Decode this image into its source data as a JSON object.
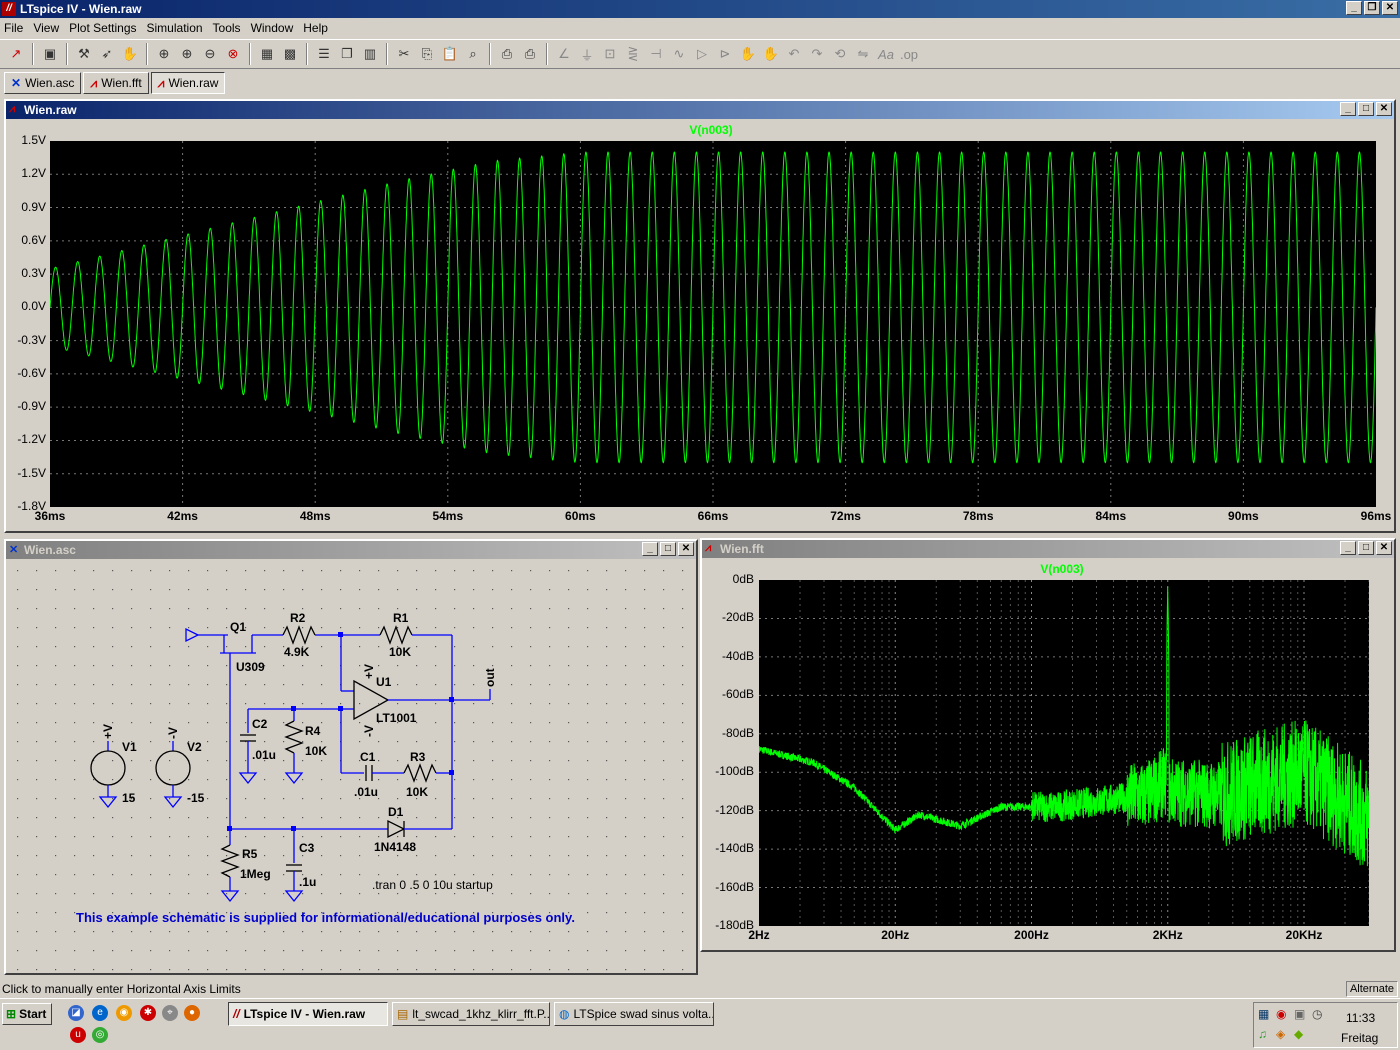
{
  "window": {
    "title": "LTspice IV - Wien.raw"
  },
  "menu": [
    "File",
    "View",
    "Plot Settings",
    "Simulation",
    "Tools",
    "Window",
    "Help"
  ],
  "tabs": [
    {
      "label": "Wien.asc",
      "icon": "schematic-icon"
    },
    {
      "label": "Wien.fft",
      "icon": "waveform-icon"
    },
    {
      "label": "Wien.raw",
      "icon": "waveform-icon"
    }
  ],
  "raw_window": {
    "title": "Wien.raw",
    "trace": "V(n003)",
    "yticks": [
      "1.5V",
      "1.2V",
      "0.9V",
      "0.6V",
      "0.3V",
      "0.0V",
      "-0.3V",
      "-0.6V",
      "-0.9V",
      "-1.2V",
      "-1.5V",
      "-1.8V"
    ],
    "xticks": [
      "36ms",
      "42ms",
      "48ms",
      "54ms",
      "60ms",
      "66ms",
      "72ms",
      "78ms",
      "84ms",
      "90ms",
      "96ms"
    ]
  },
  "asc_window": {
    "title": "Wien.asc",
    "labels": {
      "q1": "Q1",
      "u309": "U309",
      "r2": "R2",
      "r2v": "4.9K",
      "r1": "R1",
      "r1v": "10K",
      "u1": "U1",
      "lt1001": "LT1001",
      "vplus": "+V",
      "vminus": "-V",
      "out": "out",
      "c2": "C2",
      "c2v": ".01u",
      "r4": "R4",
      "r4v": "10K",
      "c1": "C1",
      "c1v": ".01u",
      "r3": "R3",
      "r3v": "10K",
      "d1": "D1",
      "d1v": "1N4148",
      "r5": "R5",
      "r5v": "1Meg",
      "c3": "C3",
      "c3v": ".1u",
      "v1": "V1",
      "v1v": "15",
      "v1n": "+V",
      "v2": "V2",
      "v2v": "-15",
      "v2n": "-V",
      "tran": ".tran 0 .5 0 10u startup",
      "notice": "This example schematic is supplied for informational/educational purposes only."
    }
  },
  "fft_window": {
    "title": "Wien.fft",
    "trace": "V(n003)",
    "yticks": [
      "0dB",
      "-20dB",
      "-40dB",
      "-60dB",
      "-80dB",
      "-100dB",
      "-120dB",
      "-140dB",
      "-160dB",
      "-180dB"
    ],
    "xticks": [
      "2Hz",
      "20Hz",
      "200Hz",
      "2KHz",
      "20KHz"
    ]
  },
  "chart_data": [
    {
      "type": "line",
      "title": "V(n003)",
      "xlabel": "",
      "ylabel": "",
      "xlim": [
        36,
        96
      ],
      "ylim": [
        -1.8,
        1.5
      ],
      "x_unit": "ms",
      "y_unit": "V",
      "series": [
        {
          "name": "V(n003)",
          "frequency_hz": 1000,
          "envelope": {
            "x": [
              36,
              40,
              44,
              48,
              52,
              56,
              60,
              96
            ],
            "amplitude": [
              0.35,
              0.55,
              0.75,
              0.95,
              1.15,
              1.32,
              1.4,
              1.4
            ]
          },
          "dc_offset": 0.0
        }
      ],
      "grid": true,
      "color": "#00ff00"
    },
    {
      "type": "line",
      "title": "V(n003)",
      "xlabel": "",
      "ylabel": "",
      "xscale": "log",
      "xlim": [
        2,
        60000
      ],
      "ylim": [
        -180,
        0
      ],
      "x_unit": "Hz",
      "y_unit": "dB",
      "series": [
        {
          "name": "V(n003)",
          "points": [
            [
              2,
              -88
            ],
            [
              5,
              -95
            ],
            [
              10,
              -108
            ],
            [
              20,
              -130
            ],
            [
              30,
              -122
            ],
            [
              60,
              -128
            ],
            [
              120,
              -118
            ],
            [
              300,
              -118
            ],
            [
              800,
              -114
            ],
            [
              1400,
              -112
            ],
            [
              1900,
              -105
            ],
            [
              2000,
              -2
            ],
            [
              2100,
              -110
            ],
            [
              5000,
              -112
            ],
            [
              10000,
              -105
            ],
            [
              20000,
              -100
            ],
            [
              40000,
              -115
            ],
            [
              60000,
              -125
            ]
          ]
        }
      ],
      "grid": true,
      "color": "#00ff00"
    }
  ],
  "status": {
    "left": "Click to manually enter Horizontal Axis Limits",
    "right": "Alternate"
  },
  "taskbar": {
    "start": "Start",
    "tasks": [
      "LTspice IV - Wien.raw",
      "lt_swcad_1khz_klirr_fft.P...",
      "LTSpice swad sinus volta..."
    ],
    "clock": "11:33",
    "day": "Freitag"
  }
}
